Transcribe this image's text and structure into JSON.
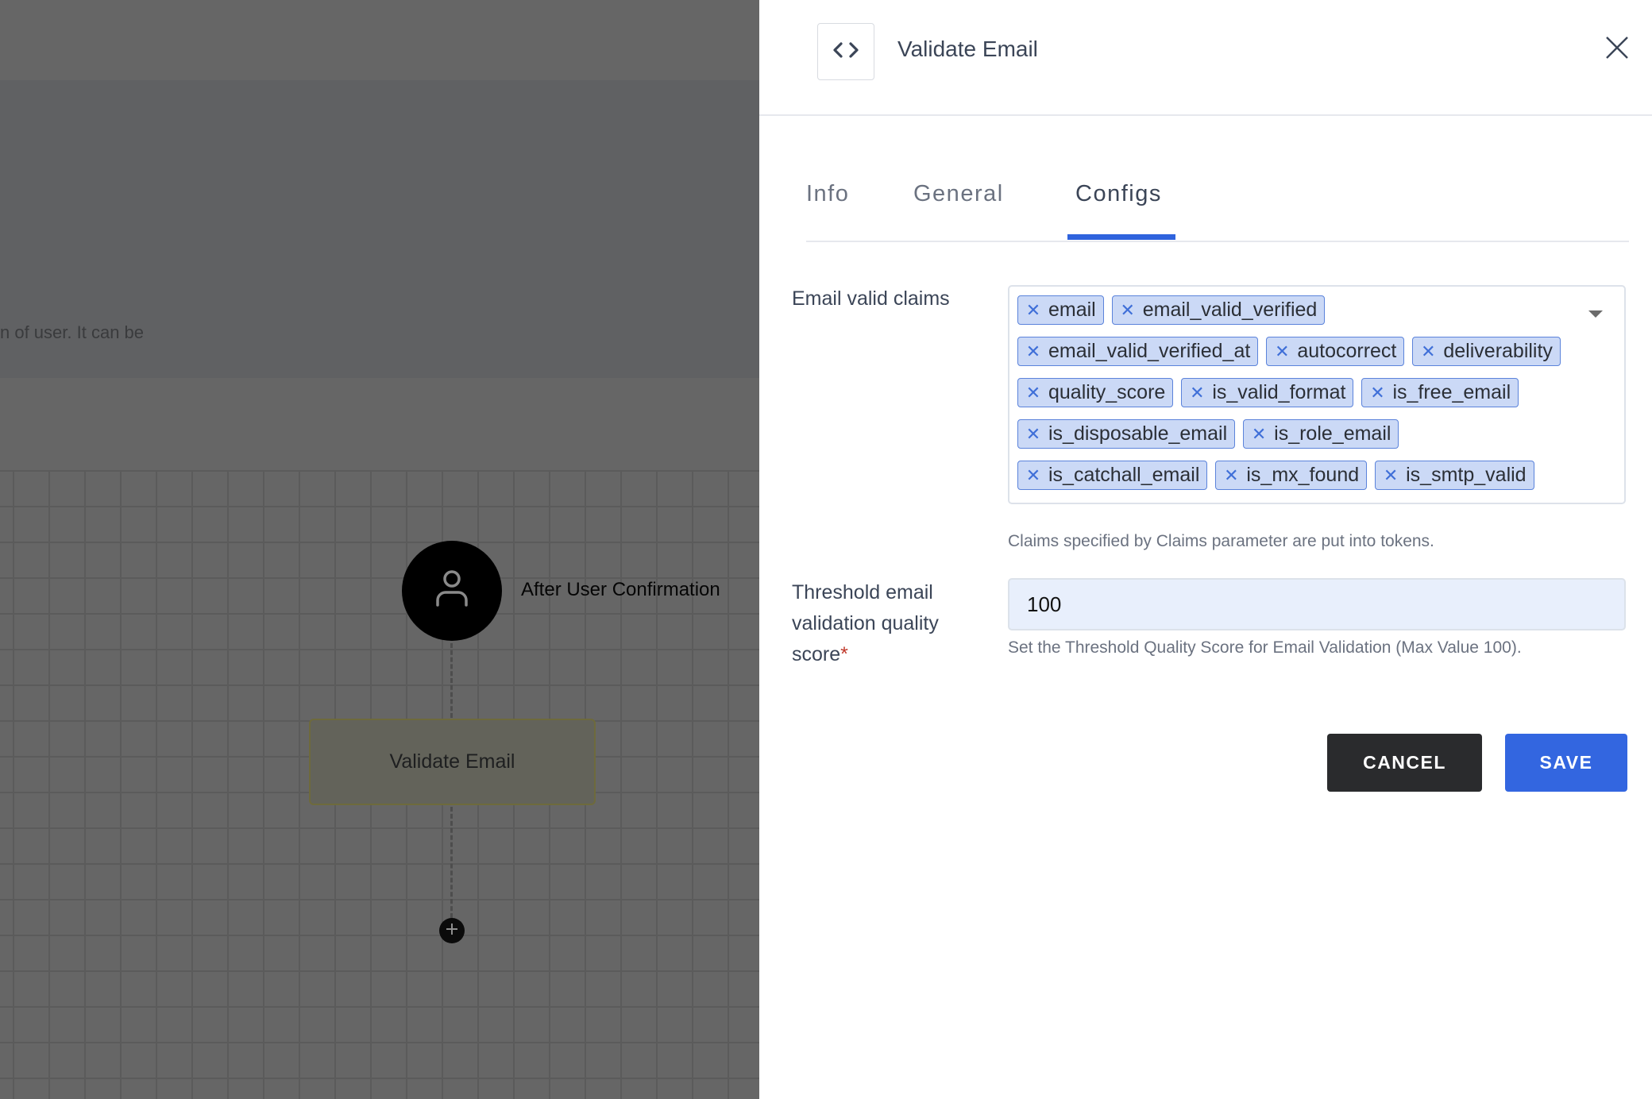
{
  "background": {
    "description_fragment": "n of user. It can be",
    "flow": {
      "trigger_label": "After User Confirmation",
      "trigger_icon": "user-icon",
      "action_label": "Validate Email",
      "add_icon": "plus-icon"
    }
  },
  "drawer": {
    "header": {
      "icon": "code-icon",
      "title": "Validate Email",
      "close_icon": "close-icon"
    },
    "tabs": [
      {
        "label": "Info",
        "active": false
      },
      {
        "label": "General",
        "active": false
      },
      {
        "label": "Configs",
        "active": true
      }
    ],
    "form": {
      "claims": {
        "label": "Email valid claims",
        "selected": [
          "email",
          "email_valid_verified",
          "email_valid_verified_at",
          "autocorrect",
          "deliverability",
          "quality_score",
          "is_valid_format",
          "is_free_email",
          "is_disposable_email",
          "is_role_email",
          "is_catchall_email",
          "is_mx_found",
          "is_smtp_valid"
        ],
        "remove_glyph": "✕",
        "helper": "Claims specified by Claims parameter are put into tokens."
      },
      "threshold": {
        "label": "Threshold email validation quality score",
        "required_mark": "*",
        "value": "100",
        "helper": "Set the Threshold Quality Score for Email Validation (Max Value 100)."
      }
    },
    "actions": {
      "cancel_label": "CANCEL",
      "save_label": "SAVE"
    }
  },
  "colors": {
    "accent": "#2f63dd",
    "save_button": "#3366e0",
    "cancel_button": "#2a2b2d",
    "chip_bg": "#cbd9f6",
    "chip_border": "#5b83db",
    "required": "#c0392b",
    "input_bg": "#e8effc"
  }
}
